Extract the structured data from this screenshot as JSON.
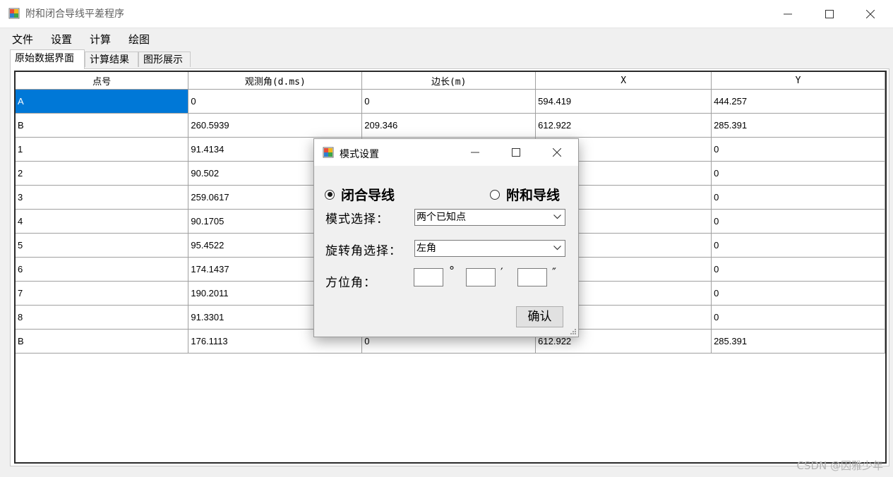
{
  "window": {
    "title": "附和闭合导线平差程序"
  },
  "menu": [
    "文件",
    "设置",
    "计算",
    "绘图"
  ],
  "tabs": [
    "原始数据界面",
    "计算结果",
    "图形展示"
  ],
  "grid": {
    "headers": [
      "点号",
      "观测角(d.ms)",
      "边长(m)",
      "X",
      "Y"
    ],
    "rows": [
      [
        "A",
        "0",
        "0",
        "594.419",
        "444.257"
      ],
      [
        "B",
        "260.5939",
        "209.346",
        "612.922",
        "285.391"
      ],
      [
        "1",
        "91.4134",
        "",
        "",
        "0"
      ],
      [
        "2",
        "90.502",
        "",
        "",
        "0"
      ],
      [
        "3",
        "259.0617",
        "",
        "",
        "0"
      ],
      [
        "4",
        "90.1705",
        "",
        "",
        "0"
      ],
      [
        "5",
        "95.4522",
        "",
        "",
        "0"
      ],
      [
        "6",
        "174.1437",
        "",
        "",
        "0"
      ],
      [
        "7",
        "190.2011",
        "",
        "",
        "0"
      ],
      [
        "8",
        "91.3301",
        "",
        "",
        "0"
      ],
      [
        "B",
        "176.1113",
        "0",
        "612.922",
        "285.391"
      ]
    ]
  },
  "dialog": {
    "title": "模式设置",
    "radio_closed": "闭合导线",
    "radio_attached": "附和导线",
    "mode_label": "模式选择：",
    "mode_value": "两个已知点",
    "rotation_label": "旋转角选择：",
    "rotation_value": "左角",
    "azimuth_label": "方位角：",
    "deg_symbol": "°",
    "min_symbol": "′",
    "sec_symbol": "″",
    "confirm": "确认"
  },
  "watermark": "CSDN @因雅少年",
  "colors": {
    "selection": "#0078d7"
  }
}
